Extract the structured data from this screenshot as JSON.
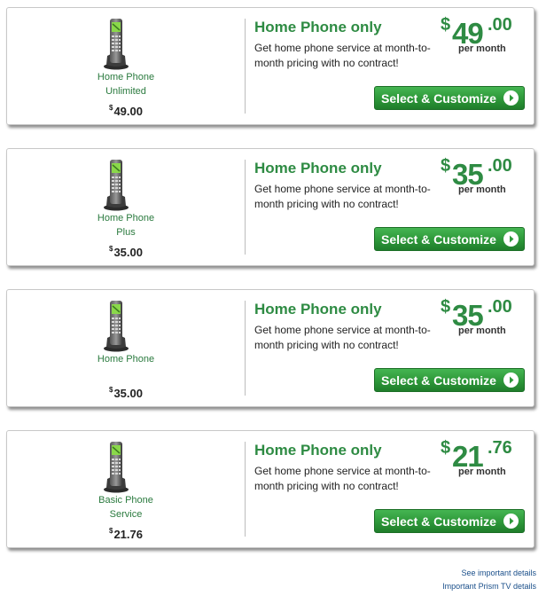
{
  "plans": [
    {
      "name": "Home Phone\nUnlimited",
      "left_price_symbol": "$",
      "left_price": "49.00",
      "title": "Home Phone only",
      "description": "Get home phone service at month-to-month pricing with no contract!",
      "currency": "$",
      "price_dollars": "49",
      "price_cents": ".00",
      "per": "per month",
      "button": "Select & Customize"
    },
    {
      "name": "Home Phone\nPlus",
      "left_price_symbol": "$",
      "left_price": "35.00",
      "title": "Home Phone only",
      "description": "Get home phone service at month-to-month pricing with no contract!",
      "currency": "$",
      "price_dollars": "35",
      "price_cents": ".00",
      "per": "per month",
      "button": "Select & Customize"
    },
    {
      "name": "Home Phone",
      "left_price_symbol": "$",
      "left_price": "35.00",
      "title": "Home Phone only",
      "description": "Get home phone service at month-to-month pricing with no contract!",
      "currency": "$",
      "price_dollars": "35",
      "price_cents": ".00",
      "per": "per month",
      "button": "Select & Customize"
    },
    {
      "name": "Basic Phone\nService",
      "left_price_symbol": "$",
      "left_price": "21.76",
      "title": "Home Phone only",
      "description": "Get home phone service at month-to-month pricing with no contract!",
      "currency": "$",
      "price_dollars": "21",
      "price_cents": ".76",
      "per": "per month",
      "button": "Select & Customize"
    }
  ],
  "icons": {
    "product": "cordless-phone-icon",
    "button": "arrow-circle-icon"
  },
  "colors": {
    "accent": "#2e8b43",
    "button": "#2f9a3b",
    "link": "#1a4f8a"
  },
  "footer": {
    "details_link": "See important details",
    "prism_link": "Important Prism TV details"
  }
}
